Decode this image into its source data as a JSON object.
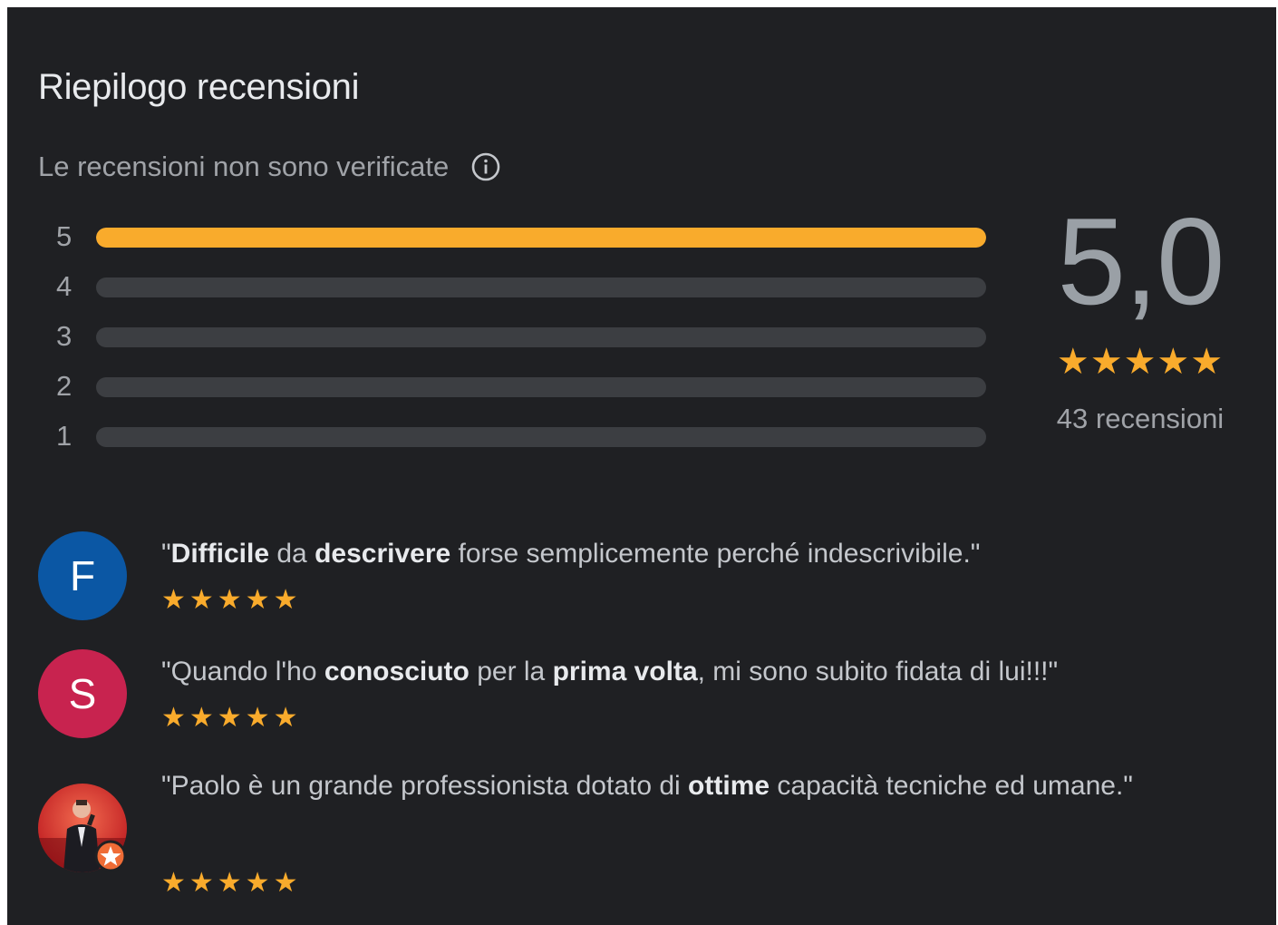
{
  "header": {
    "title": "Riepilogo recensioni",
    "subtitle": "Le recensioni non sono verificate"
  },
  "rating_bars": [
    {
      "label": "5",
      "fraction": 1.0
    },
    {
      "label": "4",
      "fraction": 0.0
    },
    {
      "label": "3",
      "fraction": 0.0
    },
    {
      "label": "2",
      "fraction": 0.0
    },
    {
      "label": "1",
      "fraction": 0.0
    }
  ],
  "summary": {
    "score": "5,0",
    "stars": "★★★★★",
    "review_count": "43 recensioni"
  },
  "reviews": [
    {
      "avatar_letter": "F",
      "avatar_color": "#0b57a4",
      "quote_parts": [
        {
          "text": "\"",
          "bold": false
        },
        {
          "text": "Difficile",
          "bold": true
        },
        {
          "text": " da ",
          "bold": false
        },
        {
          "text": "descrivere",
          "bold": true
        },
        {
          "text": " forse semplicemente perché indescrivibile.\"",
          "bold": false
        }
      ],
      "stars": "★★★★★"
    },
    {
      "avatar_letter": "S",
      "avatar_color": "#c8234f",
      "quote_parts": [
        {
          "text": "\"Quando l'ho ",
          "bold": false
        },
        {
          "text": "conosciuto",
          "bold": true
        },
        {
          "text": " per la ",
          "bold": false
        },
        {
          "text": "prima volta",
          "bold": true
        },
        {
          "text": ", mi sono subito fidata di lui!!!\"",
          "bold": false
        }
      ],
      "stars": "★★★★★"
    },
    {
      "avatar_letter": "",
      "avatar_color": "#d9302a",
      "quote_parts": [
        {
          "text": "\"Paolo è un grande professionista dotato di ",
          "bold": false
        },
        {
          "text": "ottime",
          "bold": true
        },
        {
          "text": " capacità tecniche ed umane.\"",
          "bold": false
        }
      ],
      "stars": "★★★★★"
    }
  ],
  "colors": {
    "background": "#1f2023",
    "accent": "#f9ab2c",
    "track": "#3c3e42"
  },
  "icons": {
    "info": "info-icon",
    "local-guide-badge": "star-badge-icon"
  }
}
